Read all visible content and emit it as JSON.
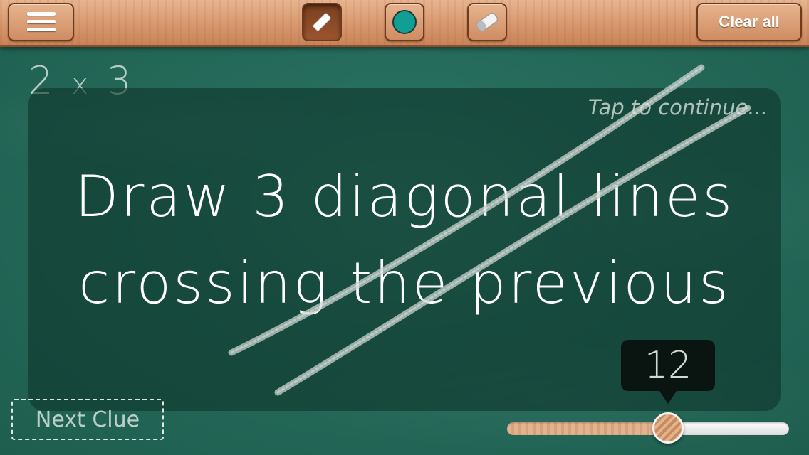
{
  "toolbar": {
    "menu_icon": "hamburger-menu-icon",
    "chalk_icon": "chalk-icon",
    "color_icon": "color-dot-icon",
    "color_value": "#119e94",
    "eraser_icon": "eraser-icon",
    "clear_label": "Clear all"
  },
  "equation": {
    "left": "2",
    "operator": "x",
    "right": "3"
  },
  "clue": {
    "tap_hint": "Tap to continue...",
    "line1": "Draw 3 diagonal lines",
    "line2": "crossing the previous"
  },
  "brush_size": {
    "value": "12",
    "fraction": 0.57
  },
  "next_clue_label": "Next Clue"
}
